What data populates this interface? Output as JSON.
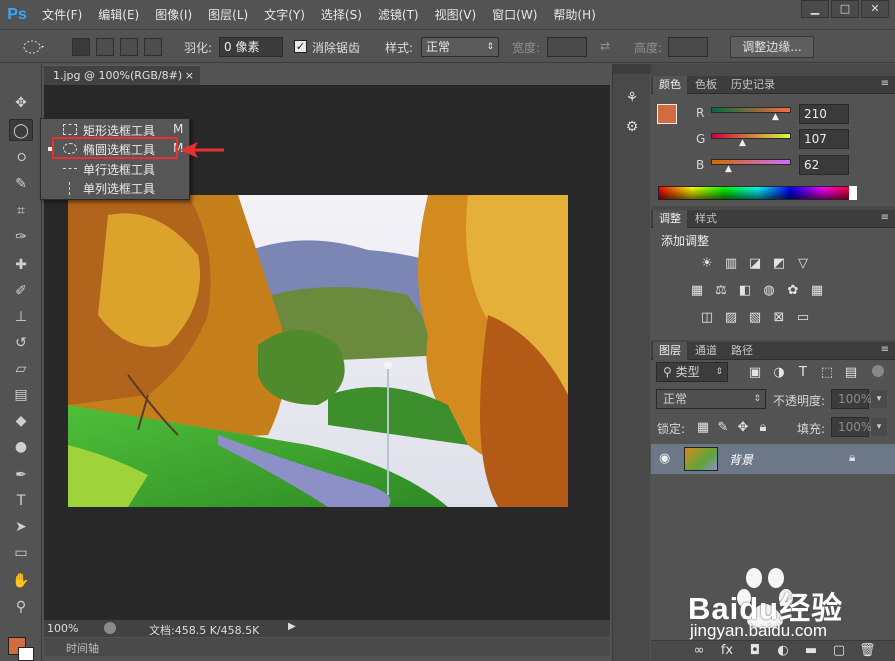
{
  "app": {
    "logo": "Ps"
  },
  "menu": [
    "文件(F)",
    "编辑(E)",
    "图像(I)",
    "图层(L)",
    "文字(Y)",
    "选择(S)",
    "滤镜(T)",
    "视图(V)",
    "窗口(W)",
    "帮助(H)"
  ],
  "window_controls": [
    "▁",
    "□",
    "✕"
  ],
  "options": {
    "feather_label": "羽化:",
    "feather_value": "0 像素",
    "antialias_label": "消除锯齿",
    "style_label": "样式:",
    "style_value": "正常",
    "width_label": "宽度:",
    "height_label": "高度:",
    "refine_edge": "调整边缘..."
  },
  "document": {
    "tab": "1.jpg @ 100%(RGB/8#)",
    "tab_close": "×",
    "zoom": "100%",
    "doc_info": "文档:458.5 K/458.5K",
    "timeline": "时间轴"
  },
  "flyout": {
    "items": [
      {
        "label": "矩形选框工具",
        "key": "M"
      },
      {
        "label": "椭圆选框工具",
        "key": "M"
      },
      {
        "label": "单行选框工具",
        "key": ""
      },
      {
        "label": "单列选框工具",
        "key": ""
      }
    ]
  },
  "color_panel": {
    "tabs": [
      "颜色",
      "色板",
      "历史记录"
    ],
    "r_label": "R",
    "g_label": "G",
    "b_label": "B",
    "r": "210",
    "g": "107",
    "b": "62",
    "foreground": "#d26b3e"
  },
  "adjust_panel": {
    "tabs": [
      "调整",
      "样式"
    ],
    "title": "添加调整"
  },
  "layers_panel": {
    "tabs": [
      "图层",
      "通道",
      "路径"
    ],
    "filter": "类型",
    "blend_mode": "正常",
    "opacity_label": "不透明度:",
    "opacity_value": "100%",
    "lock_label": "锁定:",
    "fill_label": "填充:",
    "fill_value": "100%",
    "layer_name": "背景"
  },
  "watermark": {
    "brand": "Baidu经验",
    "url": "jingyan.baidu.com"
  }
}
